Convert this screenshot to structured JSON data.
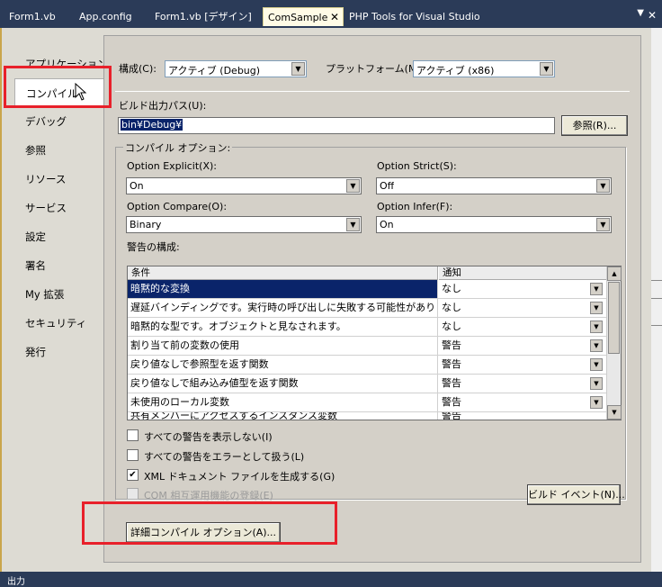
{
  "tabs": [
    {
      "label": "Form1.vb"
    },
    {
      "label": "App.config"
    },
    {
      "label": "Form1.vb [デザイン]"
    },
    {
      "label": "ComSample",
      "active": true
    },
    {
      "label": "PHP Tools for Visual Studio"
    }
  ],
  "sidebar": {
    "items": [
      "アプリケーション",
      "コンパイル",
      "デバッグ",
      "参照",
      "リソース",
      "サービス",
      "設定",
      "署名",
      "My 拡張",
      "セキュリティ",
      "発行"
    ],
    "selected_index": 1
  },
  "config": {
    "label": "構成(C):",
    "value": "アクティブ (Debug)"
  },
  "platform": {
    "label": "プラットフォーム(M):",
    "value": "アクティブ (x86)"
  },
  "output_path": {
    "label": "ビルド出力パス(U):",
    "value": "bin¥Debug¥",
    "browse_label": "参照(R)..."
  },
  "compile_options": {
    "title": "コンパイル オプション:",
    "explicit": {
      "label": "Option Explicit(X):",
      "value": "On"
    },
    "strict": {
      "label": "Option Strict(S):",
      "value": "Off"
    },
    "compare": {
      "label": "Option Compare(O):",
      "value": "Binary"
    },
    "infer": {
      "label": "Option Infer(F):",
      "value": "On"
    }
  },
  "warnings": {
    "label": "警告の構成:",
    "columns": [
      "条件",
      "通知"
    ],
    "rows": [
      {
        "condition": "暗黙的な変換",
        "notify": "なし"
      },
      {
        "condition": "遅延バインディングです。実行時の呼び出しに失敗する可能性がありま...",
        "notify": "なし"
      },
      {
        "condition": "暗黙的な型です。オブジェクトと見なされます。",
        "notify": "なし"
      },
      {
        "condition": "割り当て前の変数の使用",
        "notify": "警告"
      },
      {
        "condition": "戻り値なしで参照型を返す関数",
        "notify": "警告"
      },
      {
        "condition": "戻り値なしで組み込み値型を返す関数",
        "notify": "警告"
      },
      {
        "condition": "未使用のローカル変数",
        "notify": "警告"
      },
      {
        "condition": "共有メンバーにアクセスするインスタンス変数",
        "notify": "警告"
      }
    ]
  },
  "checkboxes": [
    {
      "label": "すべての警告を表示しない(I)",
      "checked": false,
      "disabled": false
    },
    {
      "label": "すべての警告をエラーとして扱う(L)",
      "checked": false,
      "disabled": false
    },
    {
      "label": "XML ドキュメント ファイルを生成する(G)",
      "checked": true,
      "disabled": false
    },
    {
      "label": "COM 相互運用機能の登録(E)",
      "checked": false,
      "disabled": true
    }
  ],
  "build_events_label": "ビルド イベント(N)...",
  "advanced_label": "詳細コンパイル オプション(A)...",
  "bottom": {
    "left": "出力"
  },
  "colors": {
    "highlight": "#e8202a",
    "tabbar": "#2b3b58",
    "active_tab": "#fffbe6",
    "selection": "#0a246a"
  }
}
